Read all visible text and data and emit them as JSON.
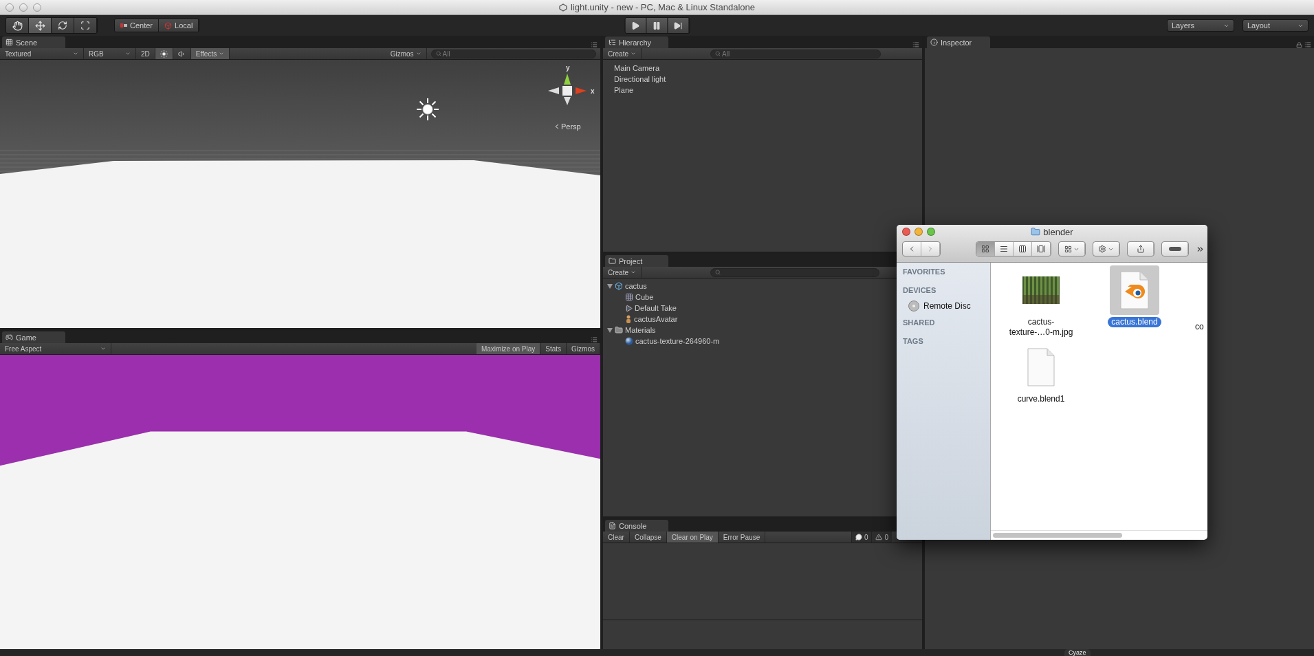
{
  "window": {
    "title": "light.unity - new - PC, Mac & Linux Standalone"
  },
  "toolbar": {
    "tools": [
      {
        "kind": "hand",
        "selected": false
      },
      {
        "kind": "move",
        "selected": true
      },
      {
        "kind": "rotate",
        "selected": false
      },
      {
        "kind": "scale",
        "selected": false
      }
    ],
    "pivot": [
      {
        "kind": "pivot",
        "label": "Center"
      },
      {
        "kind": "space",
        "label": "Local"
      }
    ],
    "playback": [
      {
        "kind": "play"
      },
      {
        "kind": "pause"
      },
      {
        "kind": "step"
      }
    ],
    "layers": "Layers",
    "layout": "Layout"
  },
  "scene": {
    "tab": "Scene",
    "render_mode": "Textured",
    "color_mode": "RGB",
    "mode_2d": "2D",
    "lighting_on": true,
    "audio_on": false,
    "effects": "Effects",
    "gizmos": "Gizmos",
    "search_placeholder": "All",
    "axis_labels": [
      "y",
      "x"
    ],
    "projection": "Persp"
  },
  "game": {
    "tab": "Game",
    "aspect": "Free Aspect",
    "buttons": [
      {
        "label": "Maximize on Play",
        "on": true
      },
      {
        "label": "Stats",
        "on": false
      },
      {
        "label": "Gizmos",
        "on": false
      }
    ]
  },
  "hierarchy": {
    "tab": "Hierarchy",
    "create": "Create",
    "search_placeholder": "All",
    "items": [
      "Main Camera",
      "Directional light",
      "Plane"
    ]
  },
  "project": {
    "tab": "Project",
    "create": "Create",
    "tree": [
      {
        "label": "cactus",
        "kind": "model",
        "expanded": true,
        "children": [
          {
            "label": "Cube",
            "kind": "mesh"
          },
          {
            "label": "Default Take",
            "kind": "animation"
          },
          {
            "label": "cactusAvatar",
            "kind": "avatar"
          }
        ]
      },
      {
        "label": "Materials",
        "kind": "folder",
        "expanded": true,
        "children": [
          {
            "label": "cactus-texture-264960-m",
            "kind": "material"
          }
        ]
      }
    ]
  },
  "console": {
    "tab": "Console",
    "buttons": [
      {
        "label": "Clear",
        "on": false
      },
      {
        "label": "Collapse",
        "on": false
      },
      {
        "label": "Clear on Play",
        "on": true
      },
      {
        "label": "Error Pause",
        "on": false
      }
    ],
    "errors": "0",
    "warnings": "0"
  },
  "inspector": {
    "tab": "Inspector"
  },
  "finder": {
    "title": "blender",
    "sidebar": [
      {
        "heading": "FAVORITES"
      },
      {
        "heading": "DEVICES",
        "items": [
          "Remote Disc"
        ]
      },
      {
        "heading": "SHARED"
      },
      {
        "heading": "TAGS"
      }
    ],
    "view_modes": [
      {
        "kind": "icons",
        "selected": true
      },
      {
        "kind": "list",
        "selected": false
      },
      {
        "kind": "columns",
        "selected": false
      },
      {
        "kind": "coverflow",
        "selected": false
      }
    ],
    "files": [
      {
        "name": "cactus-\ntexture-…0-m.jpg",
        "selected": false
      },
      {
        "name": "cactus.blend",
        "kind": "blend",
        "selected": true
      },
      {
        "name": "co",
        "kind": "partial",
        "selected": false
      },
      {
        "name": "curve.blend1",
        "kind": "document",
        "selected": false
      }
    ]
  },
  "dock_label": "Cyaze"
}
